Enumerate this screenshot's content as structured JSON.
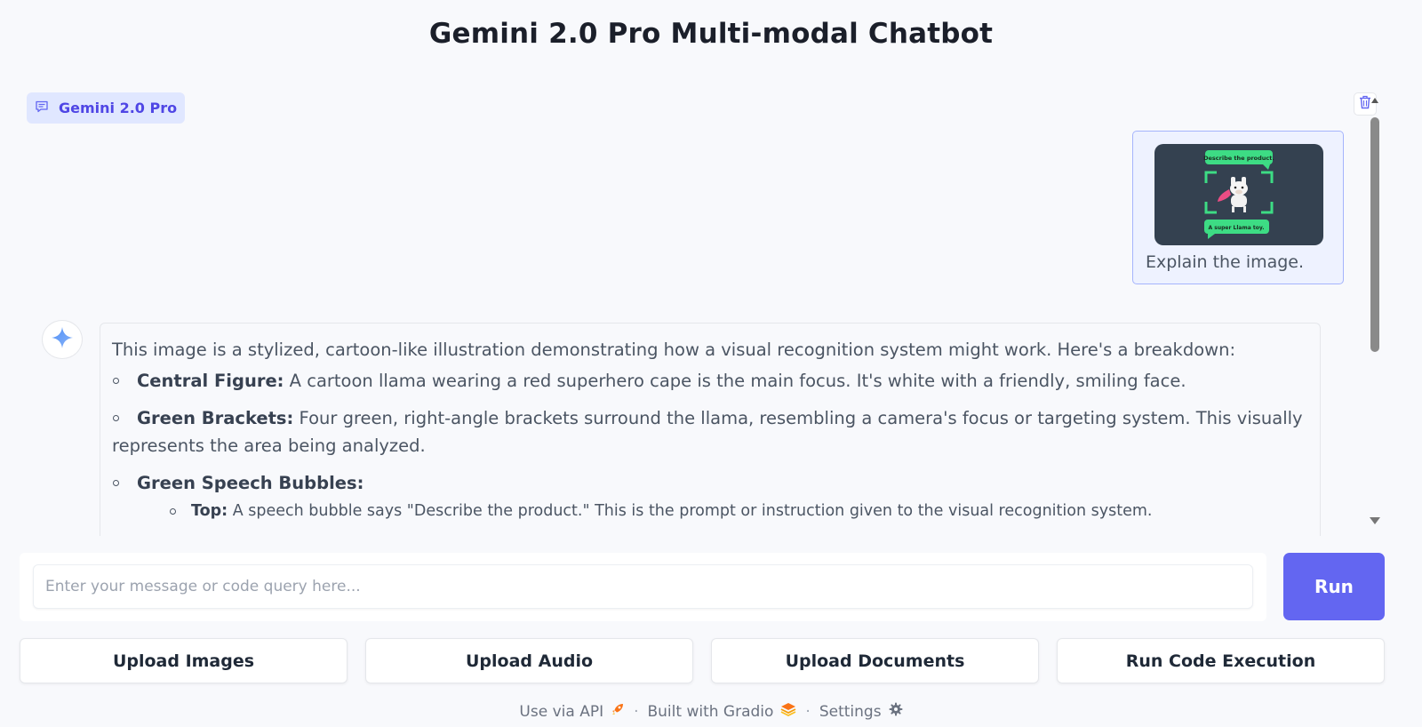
{
  "page": {
    "title": "Gemini 2.0 Pro Multi-modal Chatbot"
  },
  "chatbot": {
    "label": "Gemini 2.0 Pro",
    "user_message": {
      "text": "Explain the image.",
      "image": {
        "top_bubble": "Describe the product.",
        "bottom_bubble": "A super Llama toy."
      }
    },
    "bot_message": {
      "intro": "This image is a stylized, cartoon-like illustration demonstrating how a visual recognition system might work. Here's a breakdown:",
      "items": [
        {
          "title": "Central Figure:",
          "text": " A cartoon llama wearing a red superhero cape is the main focus. It's white with a friendly, smiling face."
        },
        {
          "title": "Green Brackets:",
          "text": " Four green, right-angle brackets surround the llama, resembling a camera's focus or targeting system. This visually represents the area being analyzed."
        },
        {
          "title": "Green Speech Bubbles:",
          "text": ""
        }
      ],
      "subitems": [
        {
          "title": "Top:",
          "text": " A speech bubble says \"Describe the product.\" This is the prompt or instruction given to the visual recognition system."
        }
      ]
    }
  },
  "input": {
    "placeholder": "Enter your message or code query here...",
    "value": ""
  },
  "buttons": {
    "run": "Run",
    "upload_images": "Upload Images",
    "upload_audio": "Upload Audio",
    "upload_documents": "Upload Documents",
    "run_code": "Run Code Execution"
  },
  "footer": {
    "api": "Use via API",
    "built": "Built with Gradio",
    "settings": "Settings",
    "separator": "·"
  },
  "colors": {
    "accent": "#6366f1",
    "badge_bg": "#e0e7ff",
    "user_bubble_bg": "#eef2ff",
    "bracket_green": "#3ddc84"
  },
  "icons": [
    "chat-icon",
    "trash-icon",
    "gemini-sparkle-icon",
    "rocket-icon",
    "gradio-logo-icon",
    "gear-icon"
  ]
}
